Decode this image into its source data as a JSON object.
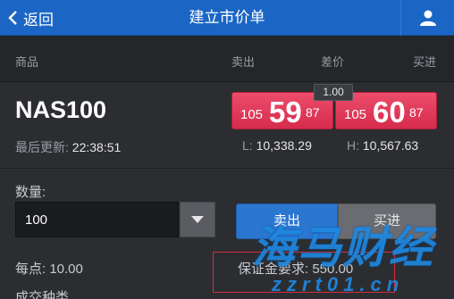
{
  "header": {
    "back_label": "返回",
    "title": "建立市价单"
  },
  "columns": {
    "product": "商品",
    "sell": "卖出",
    "spread": "差价",
    "buy": "买进"
  },
  "instrument": {
    "symbol": "NAS100",
    "last_update_label": "最后更新:",
    "last_update_time": "22:38:51",
    "spread_value": "1.00",
    "sell_price": {
      "prefix": "105",
      "big": "59",
      "suffix": "87"
    },
    "buy_price": {
      "prefix": "105",
      "big": "60",
      "suffix": "87"
    },
    "low_label": "L:",
    "low_value": "10,338.29",
    "high_label": "H:",
    "high_value": "10,567.63"
  },
  "order": {
    "quantity_label": "数量:",
    "quantity_value": "100",
    "sell_label": "卖出",
    "buy_label": "买进",
    "per_point": "每点: 10.00",
    "margin": "保证金要求: 550.00",
    "bottom_label": "成交种类"
  },
  "watermark": {
    "brand": "海马财经",
    "url": "zzrt01.cn"
  },
  "colors": {
    "header_bg": "#1b66c4",
    "price_red": "#e03a59",
    "sell_selected": "#2b76cf",
    "watermark": "#1f88e0"
  }
}
